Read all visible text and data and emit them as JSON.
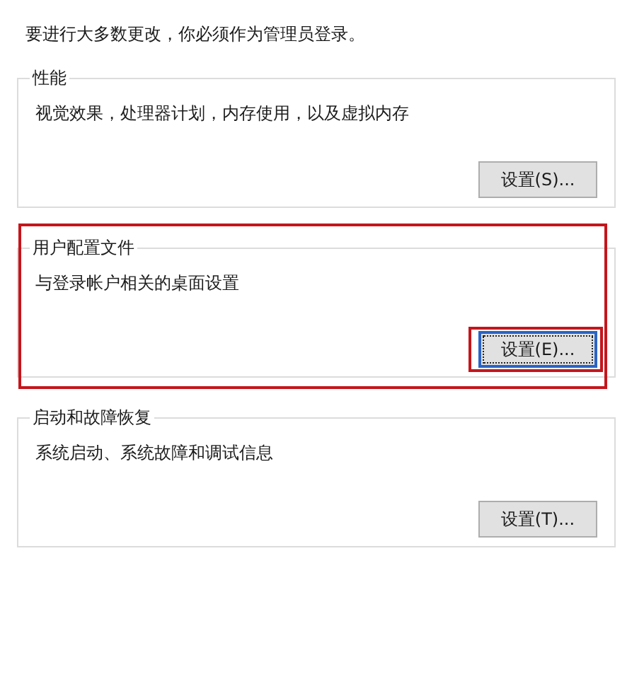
{
  "intro": "要进行大多数更改，你必须作为管理员登录。",
  "groups": [
    {
      "title": "性能",
      "description": "视觉效果，处理器计划，内存使用，以及虚拟内存",
      "highlighted": false,
      "button": {
        "label": "设置(S)...",
        "focused": false,
        "highlighted": false
      }
    },
    {
      "title": "用户配置文件",
      "description": "与登录帐户相关的桌面设置",
      "highlighted": true,
      "button": {
        "label": "设置(E)...",
        "focused": true,
        "highlighted": true
      }
    },
    {
      "title": "启动和故障恢复",
      "description": "系统启动、系统故障和调试信息",
      "highlighted": false,
      "button": {
        "label": "设置(T)...",
        "focused": false,
        "highlighted": false
      }
    }
  ]
}
